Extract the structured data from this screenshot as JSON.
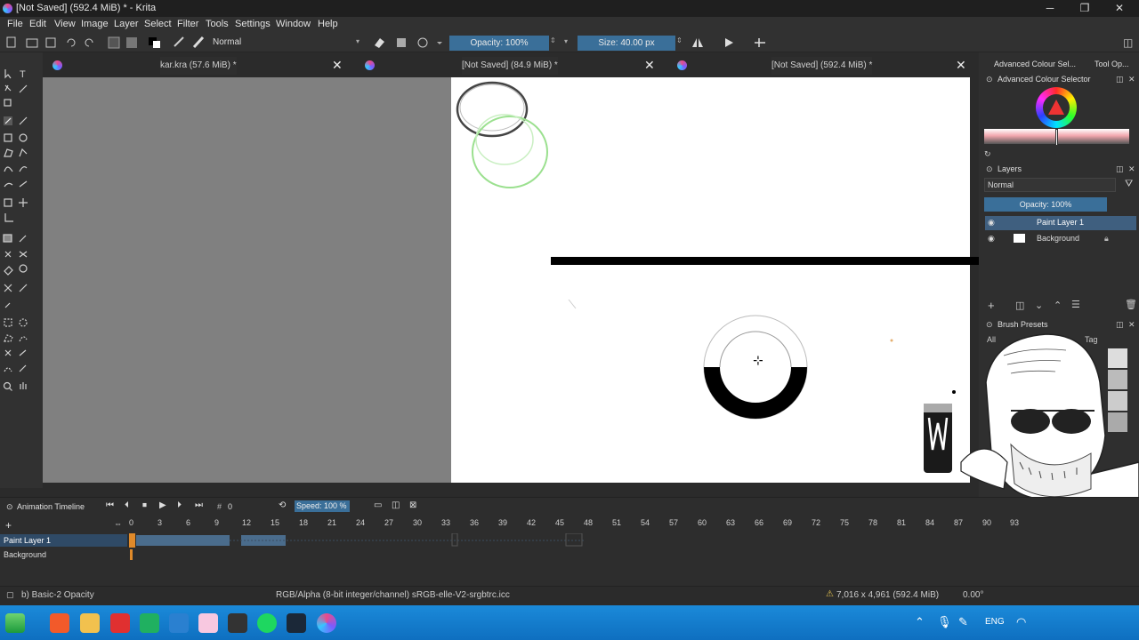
{
  "window": {
    "title": "[Not Saved] (592.4 MiB) * - Krita",
    "minimize": "─",
    "maximize": "❐",
    "close": "✕"
  },
  "menu": [
    "File",
    "Edit",
    "View",
    "Image",
    "Layer",
    "Select",
    "Filter",
    "Tools",
    "Settings",
    "Window",
    "Help"
  ],
  "toolbar": {
    "blend_mode": "Normal",
    "opacity": "Opacity: 100%",
    "size": "Size: 40.00 px"
  },
  "tabs": [
    {
      "label": "kar.kra (57.6 MiB) *"
    },
    {
      "label": "[Not Saved]  (84.9 MiB) *"
    },
    {
      "label": "[Not Saved]  (592.4 MiB) *"
    }
  ],
  "docker": {
    "tab_colour": "Advanced Colour Sel...",
    "tab_tool": "Tool Op...",
    "colour_selector_title": "Advanced Colour Selector",
    "layers_title": "Layers",
    "layers_blend": "Normal",
    "layers_opacity": "Opacity:  100%",
    "layers": [
      {
        "name": "Paint Layer 1"
      },
      {
        "name": "Background"
      }
    ],
    "brush_presets_title": "Brush Presets",
    "brush_filter": "All",
    "brush_tag": "Tag"
  },
  "timeline": {
    "title": "Animation Timeline",
    "frame_field": "0",
    "speed": "Speed: 100 %",
    "frame_numbers": [
      "0",
      "3",
      "6",
      "9",
      "12",
      "15",
      "18",
      "21",
      "24",
      "27",
      "30",
      "33",
      "36",
      "39",
      "42",
      "45",
      "48",
      "51",
      "54",
      "57",
      "60",
      "63",
      "66",
      "69",
      "72",
      "75",
      "78",
      "81",
      "84",
      "87",
      "90",
      "93"
    ],
    "layers": [
      {
        "name": "Paint Layer 1"
      },
      {
        "name": "Background"
      }
    ]
  },
  "status": {
    "brush": "b) Basic-2 Opacity",
    "color_info": "RGB/Alpha (8-bit integer/channel)  sRGB-elle-V2-srgbtrc.icc",
    "dimensions": "7,016 x 4,961 (592.4 MiB)",
    "rotation": "0.00°"
  },
  "taskbar": {
    "language": "ENG"
  },
  "colors": {
    "accent": "#3a6f99",
    "taskbar": "#1677c9",
    "canvas_bg": "#808080"
  }
}
